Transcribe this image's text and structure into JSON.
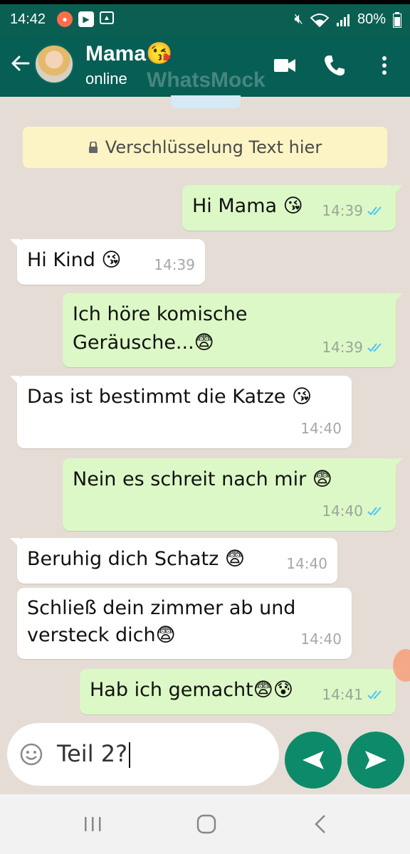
{
  "status_bar": {
    "time": "14:42",
    "battery": "80%"
  },
  "header": {
    "contact_name": "Mama",
    "contact_emoji": "😘",
    "status": "online",
    "watermark": "WhatsMock"
  },
  "encryption_notice": "Verschlüsselung Text hier",
  "messages": [
    {
      "direction": "out",
      "text": "Hi Mama 😘",
      "time": "14:39"
    },
    {
      "direction": "in",
      "text": "Hi Kind 😘",
      "time": "14:39"
    },
    {
      "direction": "out",
      "text": "Ich höre komische Geräusche...😨",
      "time": "14:39"
    },
    {
      "direction": "in",
      "text": "Das ist bestimmt die Katze 😘",
      "time": "14:40"
    },
    {
      "direction": "out",
      "text": "Nein es schreit nach mir 😨",
      "time": "14:40"
    },
    {
      "direction": "in",
      "text": "Beruhig dich Schatz 😨",
      "time": "14:40"
    },
    {
      "direction": "in",
      "text": "Schließ dein zimmer ab und versteck dich😨",
      "time": "14:40"
    },
    {
      "direction": "out",
      "text": "Hab ich gemacht😨😰",
      "time": "14:41"
    }
  ],
  "input": {
    "value": "Teil 2?"
  },
  "colors": {
    "header": "#075e54",
    "outgoing_bubble": "#dcf8c6",
    "incoming_bubble": "#ffffff",
    "send_button": "#0d8a6a",
    "read_ticks": "#4fc3f7"
  }
}
